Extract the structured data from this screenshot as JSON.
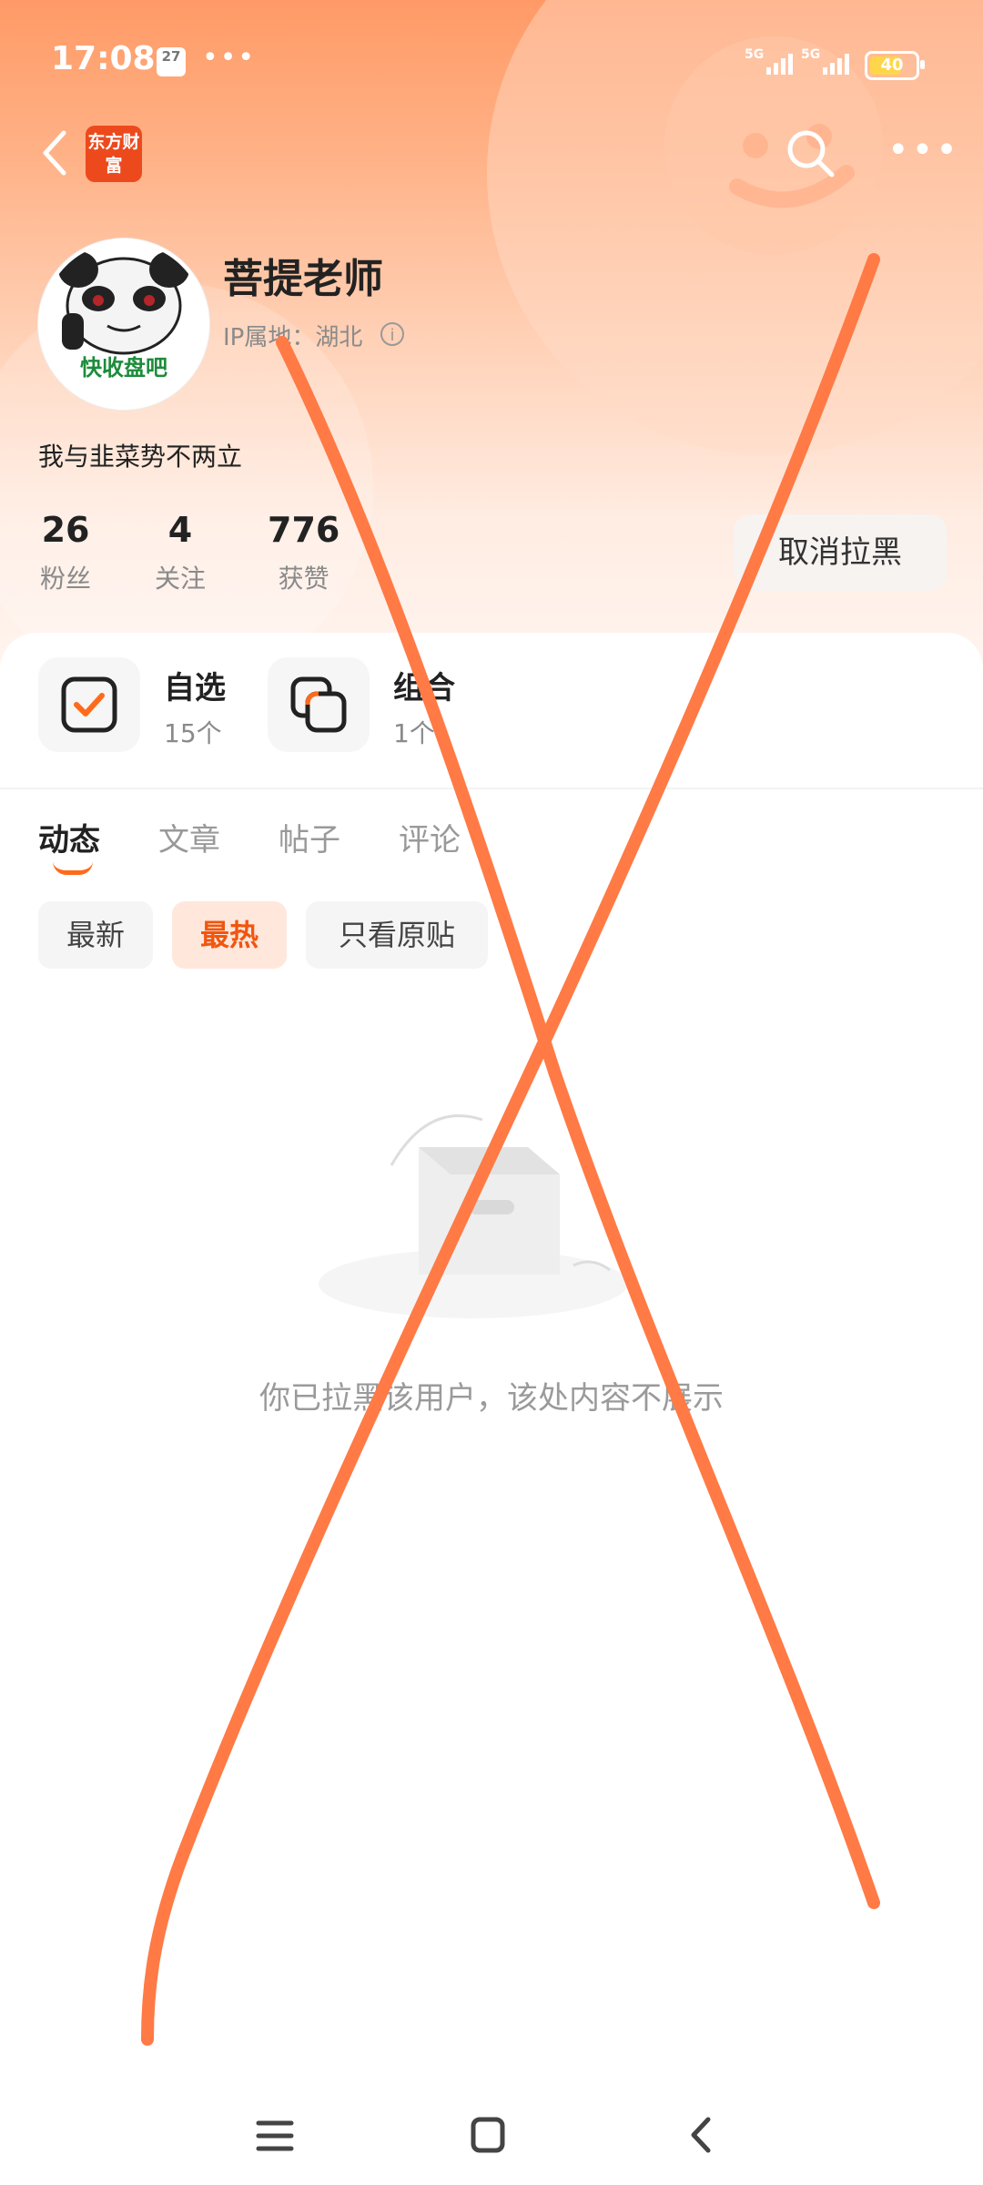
{
  "status_bar": {
    "time": "17:08",
    "calendar_day": "27",
    "more_dots": "•••",
    "sim1_label": "5G",
    "sim2_label": "5G",
    "battery": "40"
  },
  "header": {
    "app_logo_text": "东方财富",
    "username": "菩提老师",
    "ip_location": "IP属地：湖北",
    "avatar_caption": "快收盘吧",
    "bio": "我与韭菜势不两立",
    "stats": [
      {
        "value": "26",
        "label": "粉丝"
      },
      {
        "value": "4",
        "label": "关注"
      },
      {
        "value": "776",
        "label": "获赞"
      }
    ],
    "unblock_label": "取消拉黑"
  },
  "tools": [
    {
      "title": "自选",
      "count": "15个",
      "icon": "checkbox-icon"
    },
    {
      "title": "组合",
      "count": "1个",
      "icon": "portfolio-icon"
    }
  ],
  "tabs": [
    {
      "label": "动态",
      "active": true
    },
    {
      "label": "文章",
      "active": false
    },
    {
      "label": "帖子",
      "active": false
    },
    {
      "label": "评论",
      "active": false
    }
  ],
  "filters": [
    {
      "label": "最新",
      "active": false
    },
    {
      "label": "最热",
      "active": true
    },
    {
      "label": "只看原贴",
      "active": false
    }
  ],
  "empty_state": {
    "message": "你已拉黑该用户，该处内容不展示"
  },
  "colors": {
    "accent": "#ff6a1a",
    "overlay_cross": "#ff7a45"
  }
}
